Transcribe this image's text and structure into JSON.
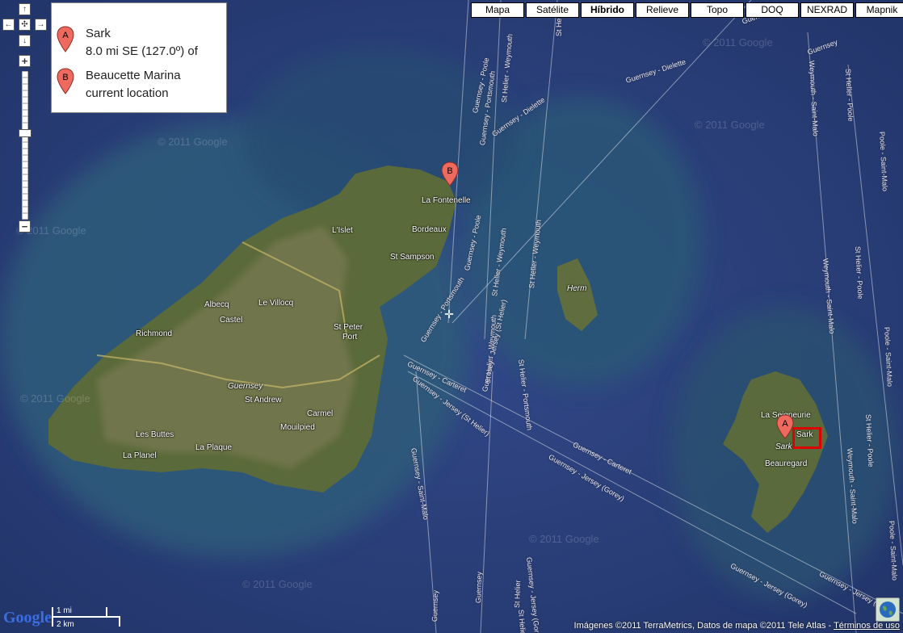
{
  "map_types": [
    "Mapa",
    "Satélite",
    "Híbrido",
    "Relieve",
    "Topo",
    "DOQ",
    "NEXRAD",
    "Mapnik"
  ],
  "active_map_type": "Híbrido",
  "legend": {
    "markerA": {
      "letter": "A",
      "line1": "Sark",
      "line2": "8.0 mi SE (127.0º) of"
    },
    "markerB": {
      "letter": "B",
      "line1": "Beaucette Marina",
      "line2": "current location"
    }
  },
  "controls": {
    "up": "↑",
    "left": "←",
    "center": "✣",
    "right": "→",
    "down": "↓",
    "zoom_in": "+",
    "zoom_out": "−"
  },
  "scale": {
    "mi": "1 mi",
    "km": "2 km"
  },
  "logo": "Google",
  "footer": {
    "text": "Imágenes ©2011 TerraMetrics, Datos de mapa ©2011 Tele Atlas - ",
    "link": "Términos de uso"
  },
  "watermark": "© 2011 Google",
  "places": [
    "La Fontenelle",
    "L'Islet",
    "Bordeaux",
    "St Sampson",
    "Albecq",
    "Le Villocq",
    "Castel",
    "Richmond",
    "St Peter",
    "Port",
    "Guernsey",
    "St Andrew",
    "Carmel",
    "Mouilpied",
    "Les Buttes",
    "La Plaque",
    "La Planel",
    "Herm",
    "La Seigneurie",
    "Sark",
    "Sark",
    "Beauregard"
  ],
  "ferry_routes": [
    "Guernsey - Poole",
    "Guernsey - Portsmouth",
    "St Helier - Weymouth",
    "Guernsey - Dielette",
    "Guernsey - Dielette",
    "Guernsey - Poole",
    "Guernsey - Portsmouth",
    "St Helier - Weymouth",
    "St Helier - Weymouth",
    "Guernsey - Carteret",
    "Guernsey - Jersey (St Helier)",
    "St Helier - Portsmouth",
    "St Helier - Weymouth",
    "Guernsey - Carteret",
    "Guernsey - Jersey (Gorey)",
    "Guernsey - Saint-Malo",
    "Guernsey - Jersey (Gorey)",
    "Guernsey - Jersey (St Helier)",
    "St Helier",
    "Weymouth - Saint-Malo",
    "St Helier - Poole",
    "Poole - Saint-Malo",
    "St Helier - Poole",
    "Weymouth - Saint-Malo",
    "Poole - Saint-Malo",
    "St Helier - Poole",
    "Weymouth - Saint-Malo",
    "Poole - Saint-Malo",
    "Guernsey - Jersey (Gorey)",
    "Guernsey - Jersey (Gorey)",
    "Guernsey",
    "St Helier",
    "Guernsey",
    "Guernsey",
    "St Helier",
    "Guernsey"
  ]
}
